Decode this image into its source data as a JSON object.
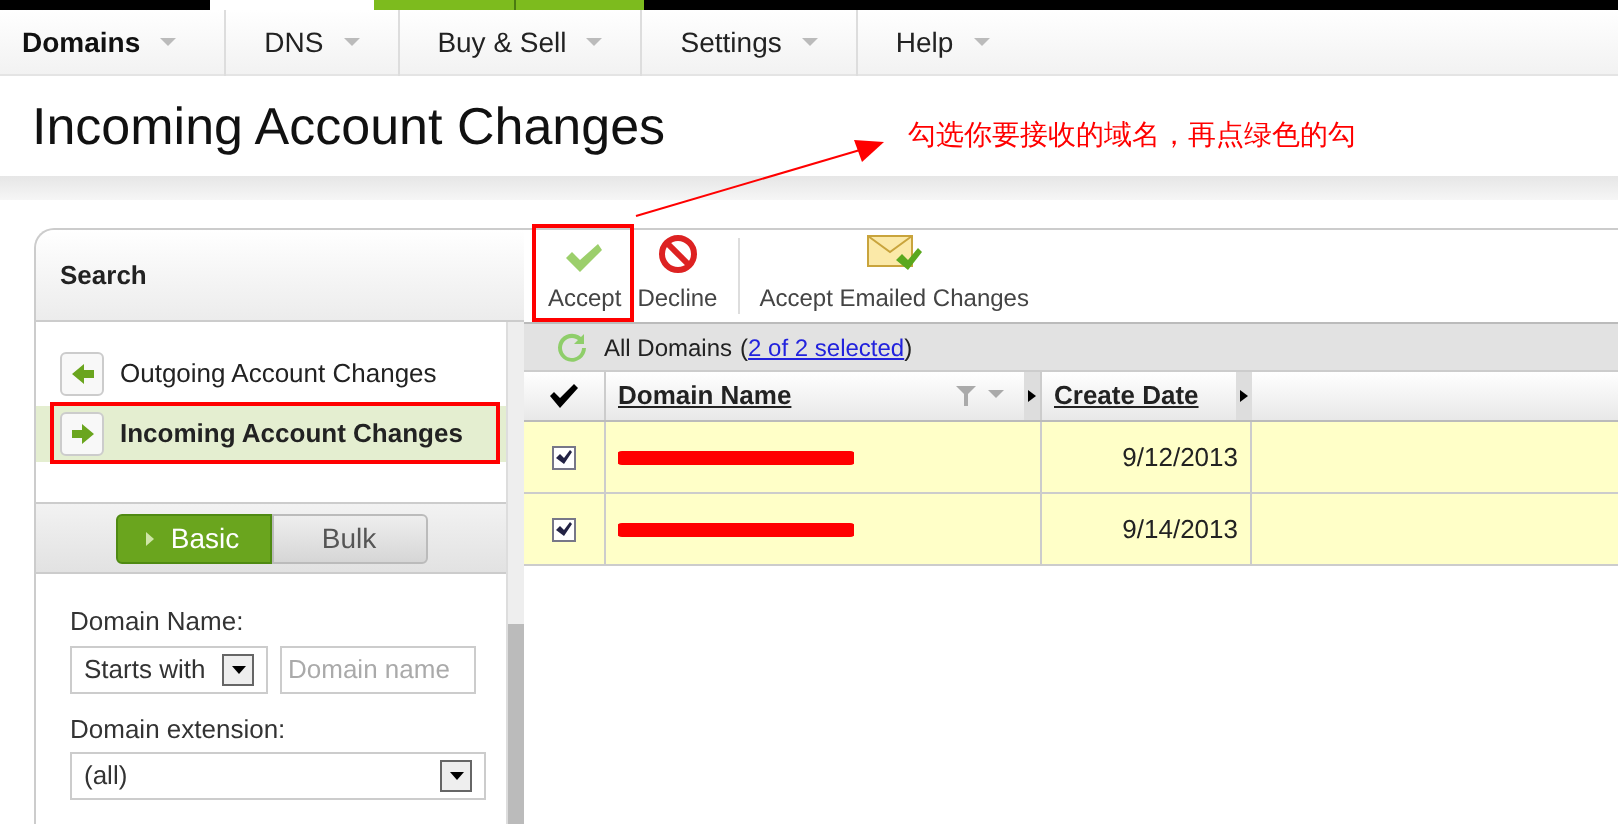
{
  "nav": [
    {
      "label": "Domains",
      "selected": true
    },
    {
      "label": "DNS",
      "selected": false
    },
    {
      "label": "Buy & Sell",
      "selected": false
    },
    {
      "label": "Settings",
      "selected": false
    },
    {
      "label": "Help",
      "selected": false
    }
  ],
  "page_title": "Incoming Account Changes",
  "annotation": "勾选你要接收的域名，再点绿色的勾",
  "sidebar": {
    "title": "Search",
    "items": [
      {
        "label": "Outgoing Account Changes",
        "selected": false,
        "kind": "back"
      },
      {
        "label": "Incoming Account Changes",
        "selected": true,
        "kind": "forward"
      }
    ],
    "modes": [
      {
        "label": "Basic",
        "selected": true
      },
      {
        "label": "Bulk",
        "selected": false
      }
    ],
    "domain_name_label": "Domain Name:",
    "match_select": "Starts with",
    "domain_input_placeholder": "Domain name",
    "extension_label": "Domain extension:",
    "extension_select": "(all)"
  },
  "toolbar": [
    {
      "label": "Accept",
      "kind": "accept"
    },
    {
      "label": "Decline",
      "kind": "decline"
    },
    {
      "label": "Accept Emailed Changes",
      "kind": "email"
    }
  ],
  "grid": {
    "caption": "All Domains",
    "selection_open": "(",
    "selection_link": "2 of 2 selected",
    "selection_close": ")",
    "columns": [
      "Domain Name",
      "Create Date"
    ],
    "rows": [
      {
        "checked": true,
        "create_date": "9/12/2013"
      },
      {
        "checked": true,
        "create_date": "9/14/2013"
      }
    ]
  }
}
